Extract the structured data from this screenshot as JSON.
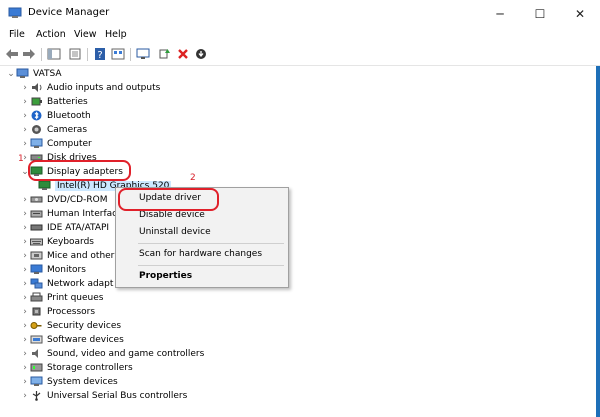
{
  "window": {
    "title": "Device Manager",
    "minimize": "─",
    "maximize": "☐",
    "close": "✕"
  },
  "menu": [
    "File",
    "Action",
    "View",
    "Help"
  ],
  "tree": {
    "root": "VATSA",
    "categories": [
      "Audio inputs and outputs",
      "Batteries",
      "Bluetooth",
      "Cameras",
      "Computer",
      "Disk drives",
      "Display adapters",
      "DVD/CD-ROM",
      "Human Interfac",
      "IDE ATA/ATAPI",
      "Keyboards",
      "Mice and other",
      "Monitors",
      "Network adapt",
      "Print queues",
      "Processors",
      "Security devices",
      "Software devices",
      "Sound, video and game controllers",
      "Storage controllers",
      "System devices",
      "Universal Serial Bus controllers"
    ],
    "display_child": "Intel(R) HD Graphics 520"
  },
  "context_menu": {
    "items": [
      "Update driver",
      "Disable device",
      "Uninstall device",
      "Scan for hardware changes",
      "Properties"
    ]
  },
  "annotations": {
    "step1": "1",
    "step2": "2"
  },
  "colors": {
    "annotation": "#e0202a",
    "selection": "#cce8ff"
  }
}
